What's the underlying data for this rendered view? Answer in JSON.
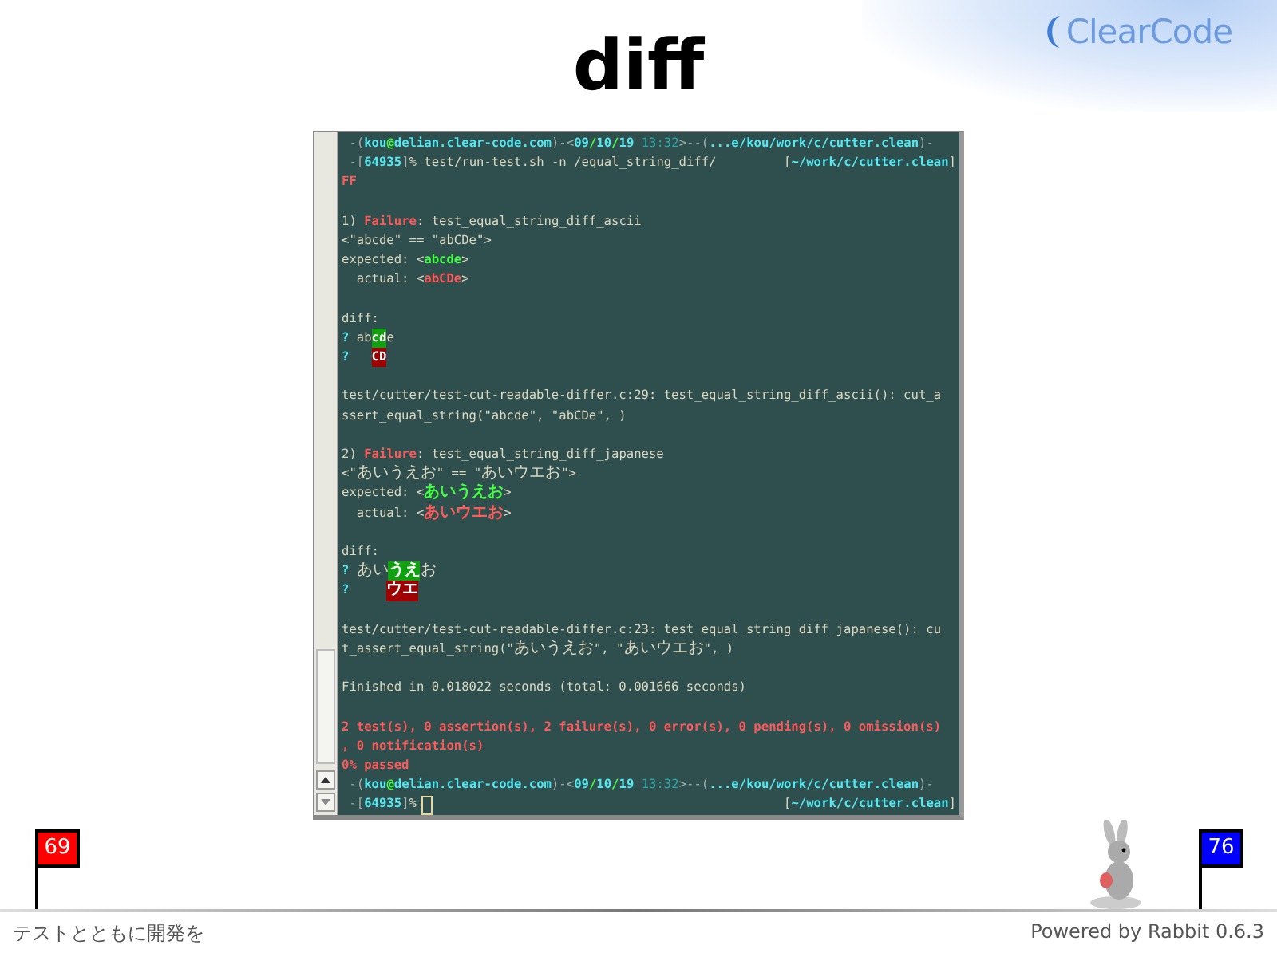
{
  "slide": {
    "title": "diff",
    "logo": "ClearCode"
  },
  "terminal": {
    "lines": [
      {
        "kind": "text",
        "segments": [
          {
            "text": " -(",
            "kind": "dim"
          },
          {
            "text": "kou",
            "kind": "cyan"
          },
          {
            "text": "@",
            "kind": "green"
          },
          {
            "text": "delian.clear-code.com",
            "kind": "cyan"
          },
          {
            "text": ")-<",
            "kind": "dim"
          },
          {
            "text": "09",
            "kind": "cyan"
          },
          {
            "text": "/",
            "kind": "green"
          },
          {
            "text": "10",
            "kind": "cyan"
          },
          {
            "text": "/",
            "kind": "green"
          },
          {
            "text": "19",
            "kind": "cyan"
          },
          {
            "text": " 13:32",
            "kind": "teal"
          },
          {
            "text": ">--(",
            "kind": "dim"
          },
          {
            "text": "...e/kou/work/c/cutter.clean",
            "kind": "cyan"
          },
          {
            "text": ")-",
            "kind": "dim"
          }
        ]
      },
      {
        "kind": "text",
        "segments": [
          {
            "text": " -[",
            "kind": "dim"
          },
          {
            "text": "64935",
            "kind": "cyan"
          },
          {
            "text": "]",
            "kind": "dim"
          },
          {
            "text": "%",
            "kind": "plain"
          },
          {
            "text": " test/run-test.sh -n /equal_string_diff/",
            "kind": "plain"
          }
        ],
        "right": [
          {
            "text": "[",
            "kind": "plain"
          },
          {
            "text": "~/work/c/cutter.clean",
            "kind": "cyan"
          },
          {
            "text": "]",
            "kind": "plain"
          }
        ]
      },
      {
        "kind": "text",
        "segments": [
          {
            "text": "FF",
            "kind": "red"
          }
        ]
      },
      {
        "kind": "blank"
      },
      {
        "kind": "text",
        "segments": [
          {
            "text": "1) ",
            "kind": "plain"
          },
          {
            "text": "Failure",
            "kind": "redbold"
          },
          {
            "text": ": test_equal_string_diff_ascii",
            "kind": "plain"
          }
        ]
      },
      {
        "kind": "text",
        "segments": [
          {
            "text": "<\"abcde\" == \"abCDe\">",
            "kind": "plain"
          }
        ]
      },
      {
        "kind": "text",
        "segments": [
          {
            "text": "expected: <",
            "kind": "plain"
          },
          {
            "text": "abcde",
            "kind": "green"
          },
          {
            "text": ">",
            "kind": "plain"
          }
        ]
      },
      {
        "kind": "text",
        "segments": [
          {
            "text": "  actual: <",
            "kind": "plain"
          },
          {
            "text": "abCDe",
            "kind": "red"
          },
          {
            "text": ">",
            "kind": "plain"
          }
        ]
      },
      {
        "kind": "blank"
      },
      {
        "kind": "text",
        "segments": [
          {
            "text": "diff:",
            "kind": "plain"
          }
        ]
      },
      {
        "kind": "text",
        "segments": [
          {
            "text": "?",
            "kind": "cyan"
          },
          {
            "text": " ab",
            "kind": "plain"
          },
          {
            "text": "cd",
            "kind": "added"
          },
          {
            "text": "e",
            "kind": "plain"
          }
        ]
      },
      {
        "kind": "text",
        "segments": [
          {
            "text": "?   ",
            "kind": "cyan"
          },
          {
            "text": "CD",
            "kind": "removed"
          }
        ]
      },
      {
        "kind": "blank"
      },
      {
        "kind": "text",
        "segments": [
          {
            "text": "test/cutter/test-cut-readable-differ.c:29: test_equal_string_diff_ascii(): cut_a",
            "kind": "plain"
          }
        ]
      },
      {
        "kind": "text",
        "segments": [
          {
            "text": "ssert_equal_string(\"abcde\", \"abCDe\", )",
            "kind": "plain"
          }
        ]
      },
      {
        "kind": "blank"
      },
      {
        "kind": "text",
        "segments": [
          {
            "text": "2) ",
            "kind": "plain"
          },
          {
            "text": "Failure",
            "kind": "redbold"
          },
          {
            "text": ": test_equal_string_diff_japanese",
            "kind": "plain"
          }
        ]
      },
      {
        "kind": "text",
        "segments": [
          {
            "text": "<\"",
            "kind": "plain"
          },
          {
            "text": "あいうえお",
            "kind": "plain"
          },
          {
            "text": "\" == \"",
            "kind": "plain"
          },
          {
            "text": "あいウエお",
            "kind": "plain"
          },
          {
            "text": "\">",
            "kind": "plain"
          }
        ]
      },
      {
        "kind": "text",
        "segments": [
          {
            "text": "expected: <",
            "kind": "plain"
          },
          {
            "text": "あいうえお",
            "kind": "green"
          },
          {
            "text": ">",
            "kind": "plain"
          }
        ]
      },
      {
        "kind": "text",
        "segments": [
          {
            "text": "  actual: <",
            "kind": "plain"
          },
          {
            "text": "あいウエお",
            "kind": "red"
          },
          {
            "text": ">",
            "kind": "plain"
          }
        ]
      },
      {
        "kind": "blank"
      },
      {
        "kind": "text",
        "segments": [
          {
            "text": "diff:",
            "kind": "plain"
          }
        ]
      },
      {
        "kind": "text",
        "segments": [
          {
            "text": "? ",
            "kind": "cyan"
          },
          {
            "text": "あい",
            "kind": "plain"
          },
          {
            "text": "うえ",
            "kind": "added"
          },
          {
            "text": "お",
            "kind": "plain"
          }
        ]
      },
      {
        "kind": "text",
        "segments": [
          {
            "text": "?     ",
            "kind": "cyan"
          },
          {
            "text": "ウエ",
            "kind": "removed"
          }
        ]
      },
      {
        "kind": "blank"
      },
      {
        "kind": "text",
        "segments": [
          {
            "text": "test/cutter/test-cut-readable-differ.c:23: test_equal_string_diff_japanese(): cu",
            "kind": "plain"
          }
        ]
      },
      {
        "kind": "text",
        "segments": [
          {
            "text": "t_assert_equal_string(\"",
            "kind": "plain"
          },
          {
            "text": "あいうえお",
            "kind": "plain"
          },
          {
            "text": "\", \"",
            "kind": "plain"
          },
          {
            "text": "あいウエお",
            "kind": "plain"
          },
          {
            "text": "\", )",
            "kind": "plain"
          }
        ]
      },
      {
        "kind": "blank"
      },
      {
        "kind": "text",
        "segments": [
          {
            "text": "Finished in 0.018022 seconds (total: 0.001666 seconds)",
            "kind": "plain"
          }
        ]
      },
      {
        "kind": "blank"
      },
      {
        "kind": "text",
        "segments": [
          {
            "text": "2 test(s), 0 assertion(s), 2 failure(s), 0 error(s), 0 pending(s), 0 omission(s)",
            "kind": "red"
          }
        ]
      },
      {
        "kind": "text",
        "segments": [
          {
            "text": ", 0 notification(s)",
            "kind": "red"
          }
        ]
      },
      {
        "kind": "text",
        "segments": [
          {
            "text": "0% passed",
            "kind": "red"
          }
        ]
      },
      {
        "kind": "text",
        "segments": [
          {
            "text": " -(",
            "kind": "dim"
          },
          {
            "text": "kou",
            "kind": "cyan"
          },
          {
            "text": "@",
            "kind": "green"
          },
          {
            "text": "delian.clear-code.com",
            "kind": "cyan"
          },
          {
            "text": ")-<",
            "kind": "dim"
          },
          {
            "text": "09",
            "kind": "cyan"
          },
          {
            "text": "/",
            "kind": "green"
          },
          {
            "text": "10",
            "kind": "cyan"
          },
          {
            "text": "/",
            "kind": "green"
          },
          {
            "text": "19",
            "kind": "cyan"
          },
          {
            "text": " 13:32",
            "kind": "teal"
          },
          {
            "text": ">--(",
            "kind": "dim"
          },
          {
            "text": "...e/kou/work/c/cutter.clean",
            "kind": "cyan"
          },
          {
            "text": ")-",
            "kind": "dim"
          }
        ]
      },
      {
        "kind": "text",
        "cursor": true,
        "segments": [
          {
            "text": " -[",
            "kind": "dim"
          },
          {
            "text": "64935",
            "kind": "cyan"
          },
          {
            "text": "]",
            "kind": "dim"
          },
          {
            "text": "%",
            "kind": "plain"
          }
        ],
        "right": [
          {
            "text": "[",
            "kind": "plain"
          },
          {
            "text": "~/work/c/cutter.clean",
            "kind": "cyan"
          },
          {
            "text": "]",
            "kind": "plain"
          }
        ]
      }
    ]
  },
  "footer": {
    "start_page": "69",
    "end_page": "76",
    "caption": "テストとともに開発を",
    "credit": "Powered by Rabbit 0.6.3"
  }
}
